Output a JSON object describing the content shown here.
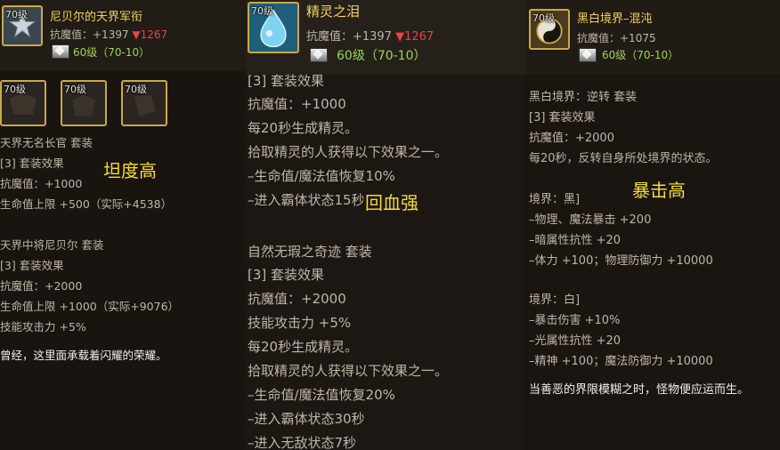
{
  "panel1": {
    "icon_level": "70级",
    "name": "尼贝尔的天界军衔",
    "stat_prefix": "抗魔值：+1397 ",
    "stat_down": "▼1267",
    "requirement": "60级（70-10）",
    "set_icons": [
      "70级",
      "70级",
      "70级"
    ],
    "lines": [
      "天界无名长官  套装",
      "[3] 套装效果",
      "抗魔值：+1000",
      "生命值上限 +500（实际+4538）",
      "天界中将尼贝尔  套装",
      "[3] 套装效果",
      "抗魔值：+2000",
      "生命值上限 +1000（实际+9076）",
      "技能攻击力 +5%",
      "曾经，这里面承载着闪耀的荣耀。"
    ],
    "note": "坦度高"
  },
  "panel2": {
    "icon_level": "70级",
    "name": "精灵之泪",
    "stat_prefix": "抗魔值：+1397 ",
    "stat_down": "▼1267",
    "requirement": "60级（70-10）",
    "lines": [
      "[3] 套装效果",
      "抗魔值：+1000",
      "每20秒生成精灵。",
      "拾取精灵的人获得以下效果之一。",
      "–生命值/魔法值恢复10%",
      "–进入霸体状态15秒",
      "自然无瑕之奇迹  套装",
      "[3] 套装效果",
      "抗魔值：+2000",
      "技能攻击力 +5%",
      "每20秒生成精灵。",
      "拾取精灵的人获得以下效果之一。",
      "–生命值/魔法值恢复20%",
      "–进入霸体状态30秒",
      "–进入无敌状态7秒"
    ],
    "note": "回血强"
  },
  "panel3": {
    "icon_level": "70级",
    "name": "黑白境界–混沌",
    "stat": "抗魔值：+1075",
    "requirement": "60级（70-10）",
    "lines": [
      "黑白境界：逆转  套装",
      "[3] 套装效果",
      "抗魔值：+2000",
      "每20秒，反转自身所处境界的状态。",
      "境界：黑]",
      "–物理、魔法暴击 +200",
      "–暗属性抗性 +20",
      "–体力 +100；物理防御力 +10000",
      "境界：白]",
      "–暴击伤害 +10%",
      "–光属性抗性 +20",
      "–精神 +100；魔法防御力 +10000",
      "当善恶的界限模糊之时，怪物便应运而生。"
    ],
    "note": "暴击高"
  },
  "colors": {
    "item_name": "#f0d35c",
    "requirement": "#9bd35a",
    "stat_down": "#e84545",
    "note": "#f3dc3a",
    "icon_border": "#c9a949"
  }
}
